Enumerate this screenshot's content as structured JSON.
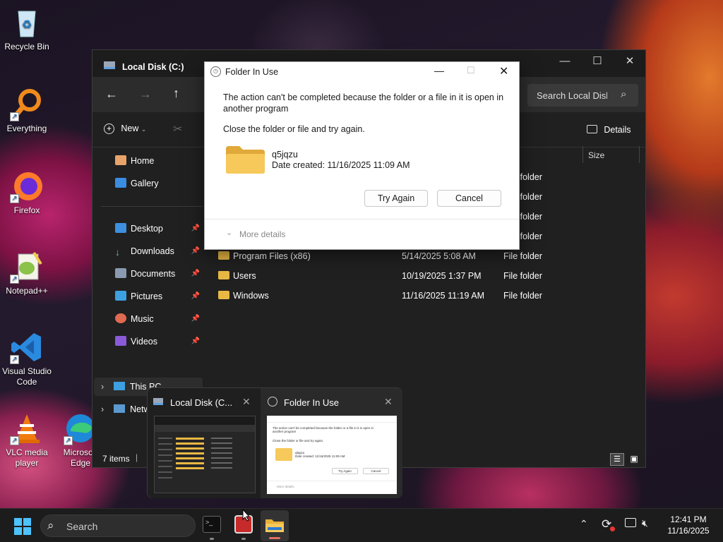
{
  "desktop": {
    "icons": [
      {
        "label": "Recycle Bin",
        "icon": "recycle-bin-icon"
      },
      {
        "label": "Everything",
        "icon": "everything-icon"
      },
      {
        "label": "Firefox",
        "icon": "firefox-icon"
      },
      {
        "label": "Notepad++",
        "icon": "notepadpp-icon"
      },
      {
        "label": "Visual Studio Code",
        "icon": "vscode-icon"
      },
      {
        "label": "VLC media player",
        "icon": "vlc-icon"
      },
      {
        "label": "Microsoft Edge",
        "icon": "edge-icon"
      }
    ]
  },
  "explorer": {
    "title": "Local Disk (C:)",
    "search_placeholder": "Search Local Disk (C:)",
    "new_label": "New",
    "details_label": "Details",
    "columns": {
      "size": "Size"
    },
    "sidebar": [
      {
        "label": "Home",
        "pinned": false
      },
      {
        "label": "Gallery",
        "pinned": false
      },
      {
        "label": "Desktop",
        "pinned": true
      },
      {
        "label": "Downloads",
        "pinned": true
      },
      {
        "label": "Documents",
        "pinned": true
      },
      {
        "label": "Pictures",
        "pinned": true
      },
      {
        "label": "Music",
        "pinned": true
      },
      {
        "label": "Videos",
        "pinned": true
      },
      {
        "label": "This PC"
      },
      {
        "label": "Network"
      }
    ],
    "rows": [
      {
        "name": "",
        "date": "",
        "type": "File folder"
      },
      {
        "name": "",
        "date": "",
        "type": "File folder"
      },
      {
        "name": "",
        "date": "",
        "type": "File folder"
      },
      {
        "name": "",
        "date": "",
        "type": "File folder"
      },
      {
        "name": "Program Files (x86)",
        "date": "5/14/2025 5:08 AM",
        "type": "File folder"
      },
      {
        "name": "Users",
        "date": "10/19/2025 1:37 PM",
        "type": "File folder"
      },
      {
        "name": "Windows",
        "date": "11/16/2025 11:19 AM",
        "type": "File folder"
      }
    ],
    "status": "7 items"
  },
  "dialog": {
    "title": "Folder In Use",
    "message": "The action can't be completed because the folder or a file in it is open in another program",
    "instruction": "Close the folder or file and try again.",
    "item_name": "q5jqzu",
    "item_date": "Date created: 11/16/2025 11:09 AM",
    "try_again": "Try Again",
    "cancel": "Cancel",
    "more_details": "More details"
  },
  "preview": {
    "tabs": [
      {
        "title": "Local Disk (C..."
      },
      {
        "title": "Folder In Use"
      }
    ]
  },
  "taskbar": {
    "search_placeholder": "Search",
    "time": "12:41 PM",
    "date": "11/16/2025"
  }
}
